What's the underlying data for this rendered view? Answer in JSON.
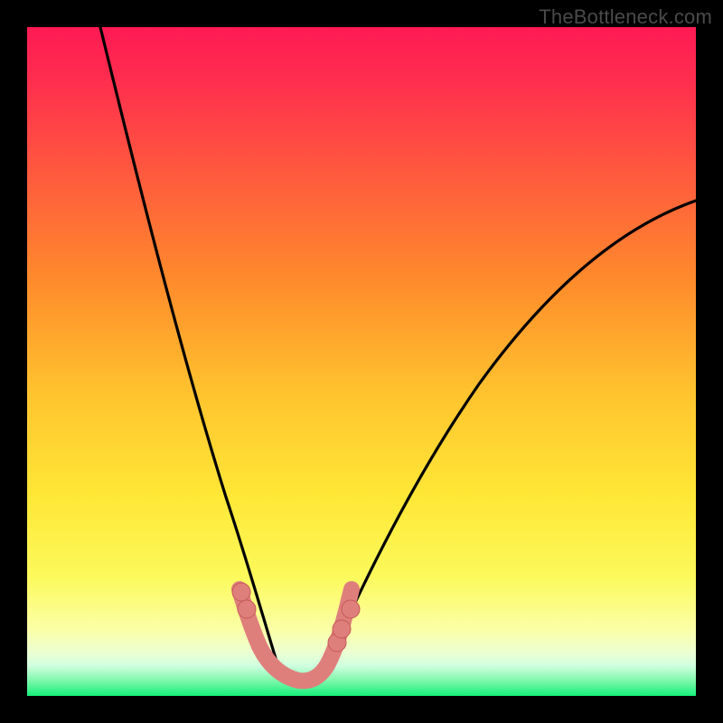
{
  "attribution": "TheBottleneck.com",
  "colors": {
    "frame": "#000000",
    "gradient_top": "#ff1a54",
    "gradient_mid1": "#ff8b2b",
    "gradient_mid2": "#ffe736",
    "gradient_mid3": "#fbffa6",
    "gradient_bottom": "#16f07a",
    "curve": "#000000",
    "marker_fill": "#e17c77",
    "marker_stroke": "#c45a57",
    "bead_fill": "#df7f7c"
  },
  "chart_data": {
    "type": "line",
    "title": "",
    "xlabel": "",
    "ylabel": "",
    "xlim": [
      0,
      100
    ],
    "ylim": [
      0,
      100
    ],
    "grid": false,
    "legend": false,
    "series": [
      {
        "name": "left-branch",
        "x": [
          11,
          14,
          17,
          20,
          23,
          25,
          27,
          29,
          31,
          32.5,
          34,
          35,
          36,
          37,
          38
        ],
        "values": [
          100,
          84,
          70,
          57,
          46,
          39,
          32,
          26,
          20,
          15.5,
          11.5,
          9,
          6.5,
          4.5,
          3
        ]
      },
      {
        "name": "right-branch",
        "x": [
          44,
          46,
          49,
          53,
          58,
          64,
          71,
          79,
          88,
          100
        ],
        "values": [
          3,
          6,
          10.5,
          17,
          25,
          34,
          44,
          54,
          63,
          74
        ]
      },
      {
        "name": "basin",
        "x": [
          32,
          33,
          34,
          35,
          36,
          37,
          38,
          39,
          40,
          41,
          42,
          43,
          44,
          45,
          46,
          47,
          48
        ],
        "values": [
          15.5,
          12.5,
          10,
          8,
          6,
          4.5,
          3.3,
          2.5,
          2.1,
          2,
          2.2,
          2.7,
          3.5,
          5,
          7,
          9.5,
          12.5
        ]
      }
    ],
    "annotations": [
      {
        "name": "bead-left-upper",
        "x": 32.0,
        "y": 15.5
      },
      {
        "name": "bead-left-lower",
        "x": 32.8,
        "y": 13.0
      },
      {
        "name": "bead-right-lower",
        "x": 46.3,
        "y": 8.0
      },
      {
        "name": "bead-right-mid",
        "x": 47.0,
        "y": 10.0
      },
      {
        "name": "bead-right-upper",
        "x": 48.3,
        "y": 13.0
      }
    ]
  }
}
